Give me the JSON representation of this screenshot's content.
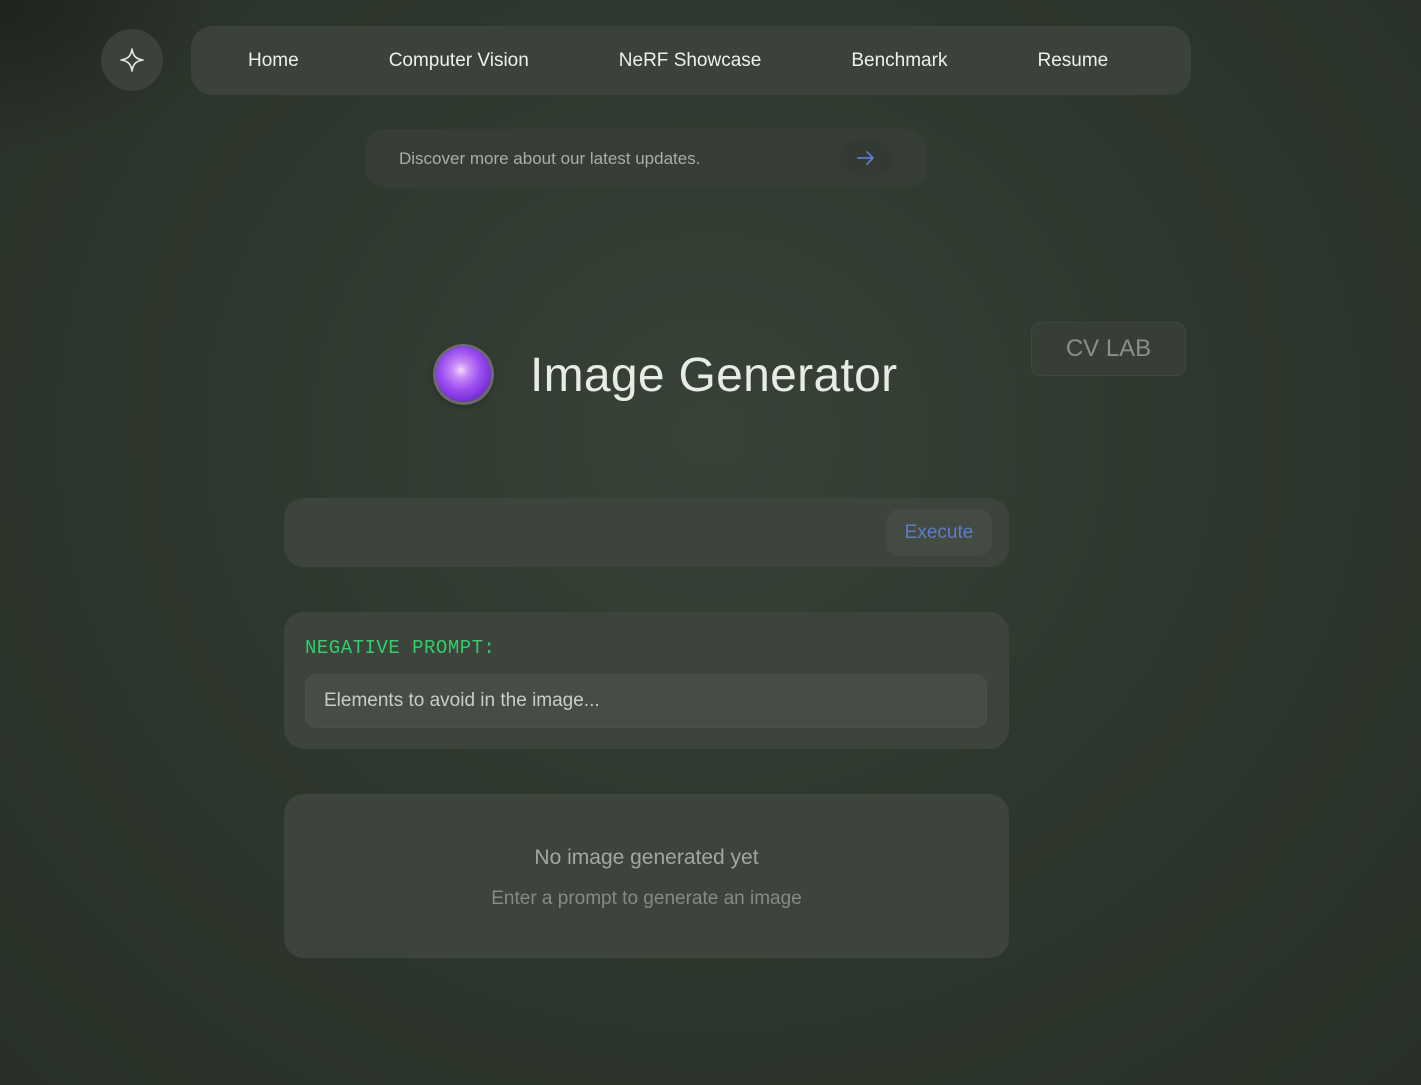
{
  "nav": {
    "logo_icon": "sparkle-icon",
    "items": [
      {
        "label": "Home"
      },
      {
        "label": "Computer Vision"
      },
      {
        "label": "NeRF Showcase"
      },
      {
        "label": "Benchmark"
      },
      {
        "label": "Resume"
      }
    ]
  },
  "announcement": {
    "text": "Discover more about our latest updates.",
    "icon": "arrow-right-icon"
  },
  "header": {
    "title": "Image Generator",
    "badge": "CV LAB"
  },
  "prompt": {
    "value": "",
    "execute_label": "Execute"
  },
  "negative_prompt": {
    "label": "NEGATIVE PROMPT:",
    "placeholder": "Elements to avoid in the image..."
  },
  "output": {
    "empty_title": "No image generated yet",
    "empty_subtitle": "Enter a prompt to generate an image"
  },
  "colors": {
    "background": "#2f382e",
    "panel": "#3c443b",
    "accent_blue": "#5b7dd1",
    "accent_green": "#2fcf6a",
    "orb_purple": "#9b4ff0"
  }
}
